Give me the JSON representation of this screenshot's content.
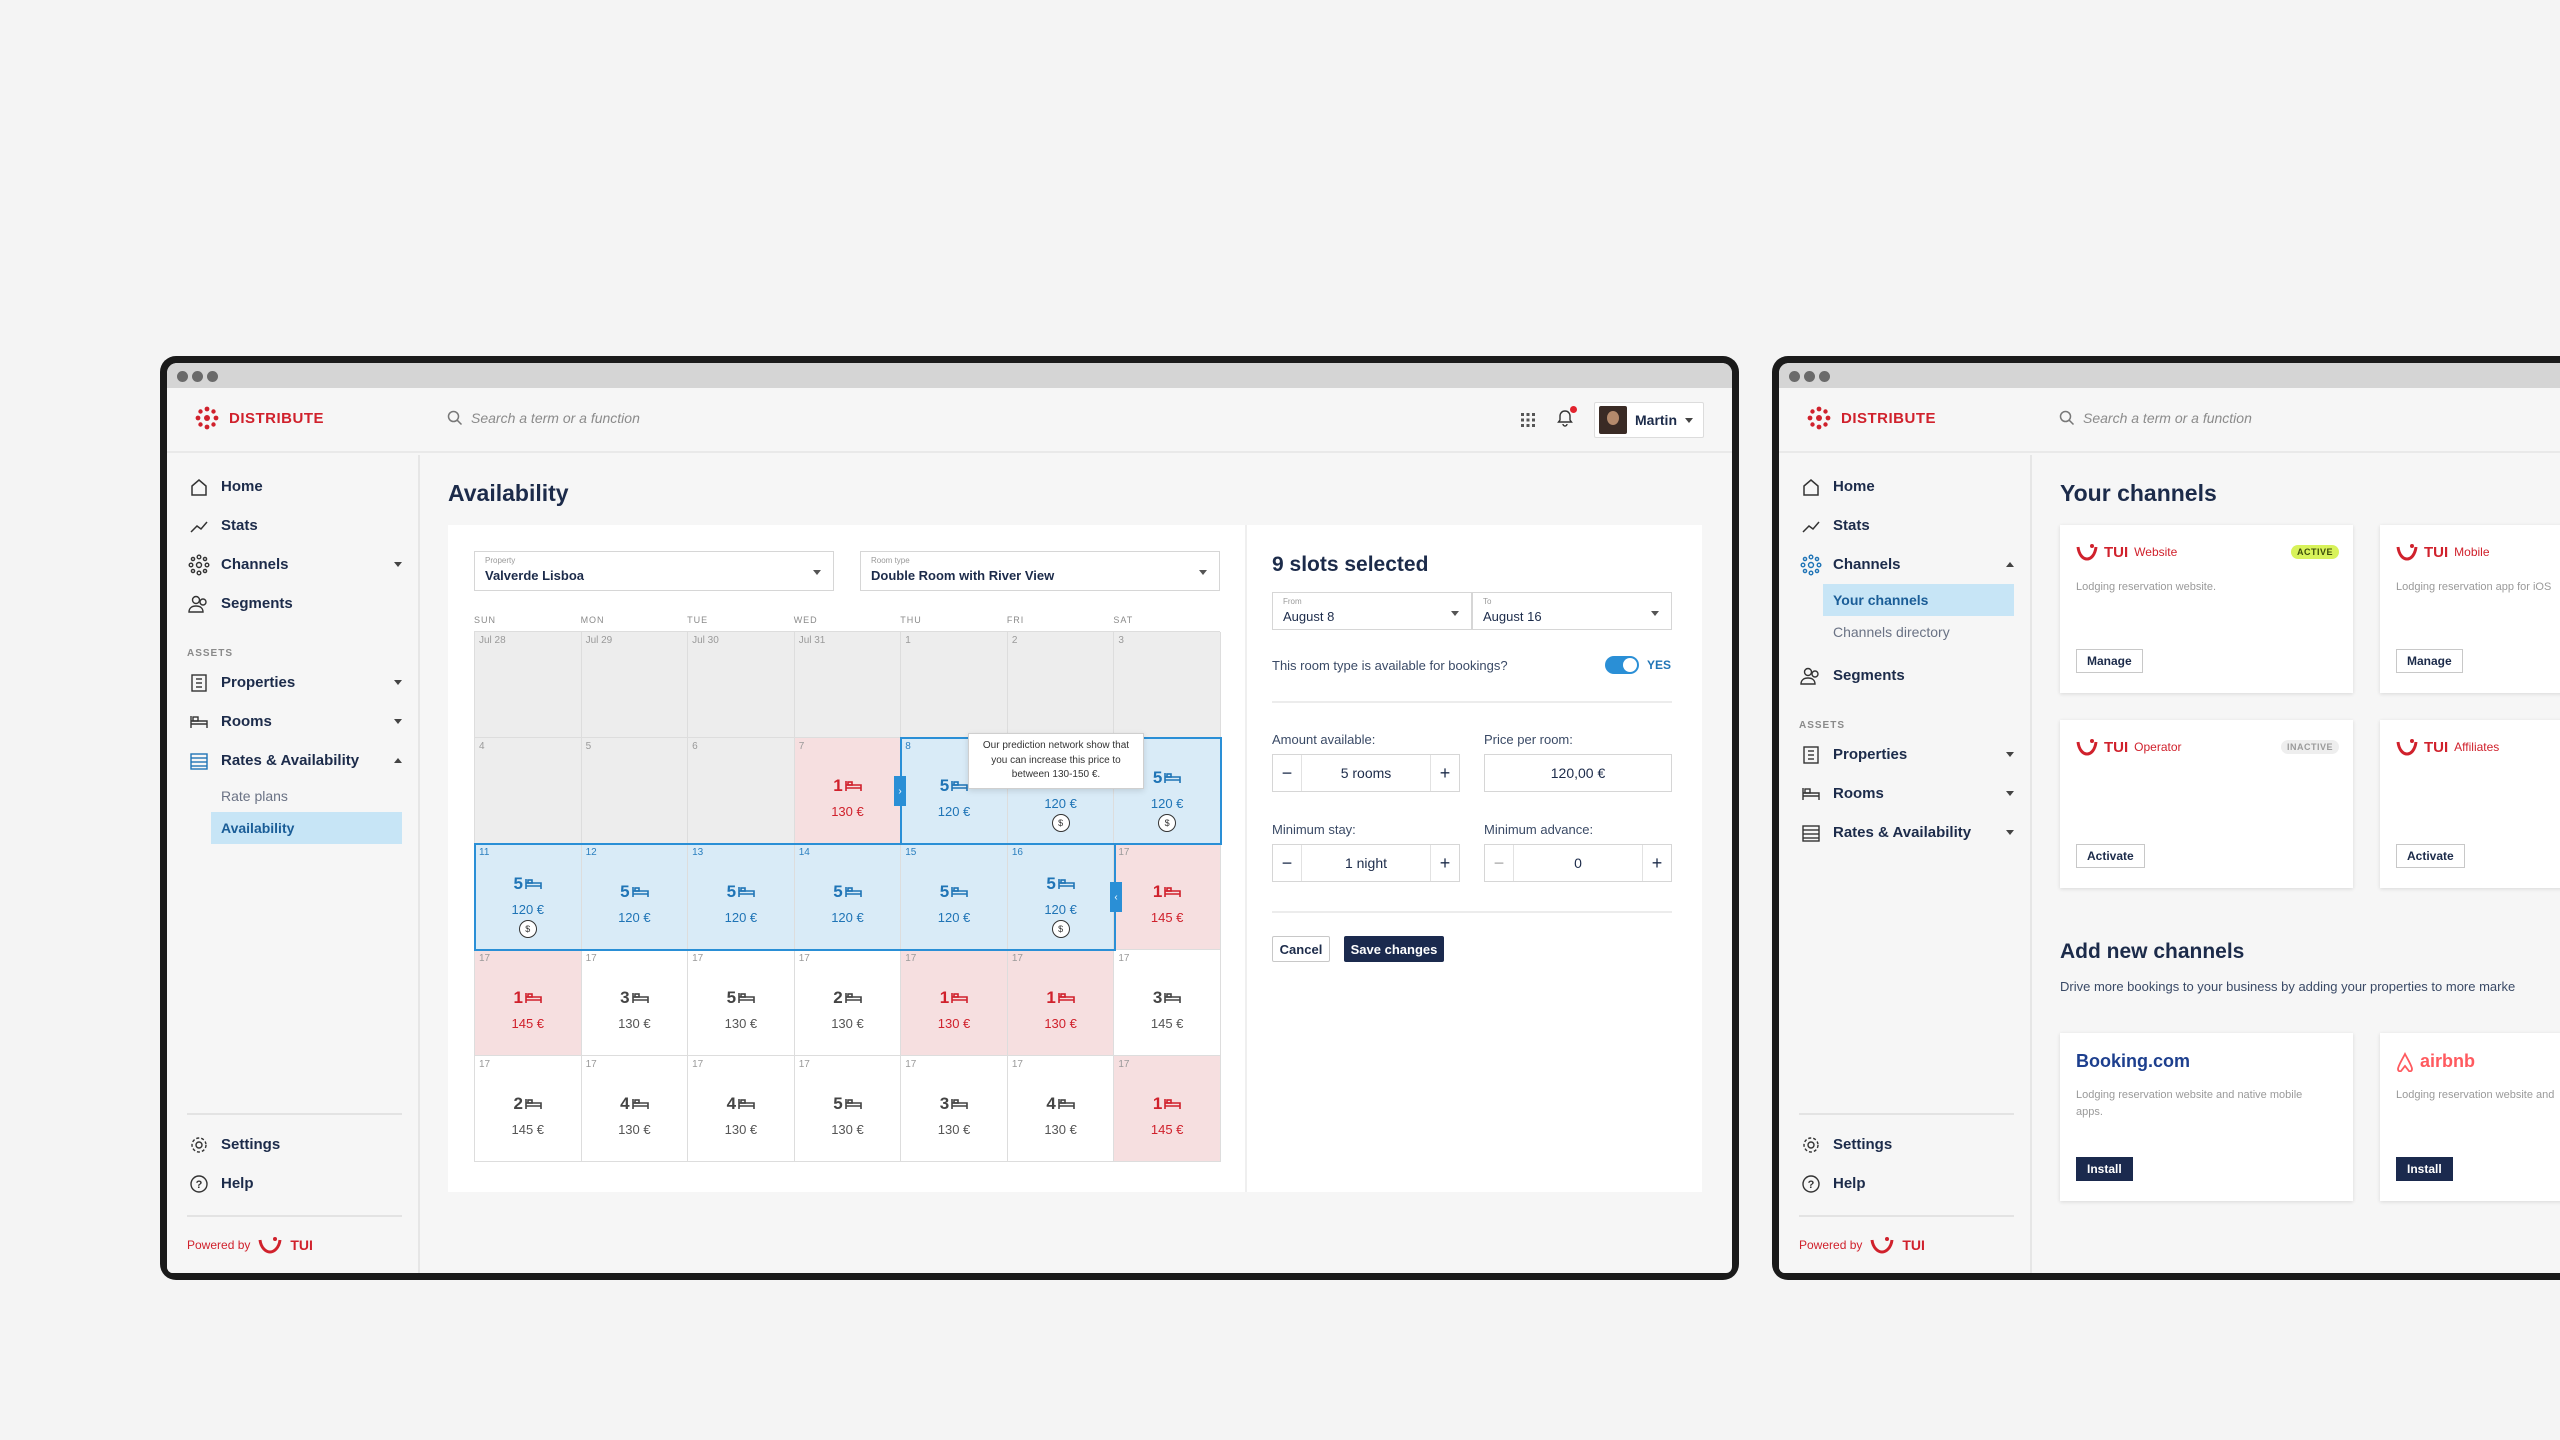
{
  "app": {
    "name": "DISTRIBUTE",
    "brand_color": "#d0212c",
    "accent": "#2a8fd6",
    "navy": "#1b2a4e"
  },
  "search": {
    "placeholder": "Search a term or a function"
  },
  "user": {
    "name": "Martin"
  },
  "sidebar": {
    "home": "Home",
    "stats": "Stats",
    "channels": "Channels",
    "segments": "Segments",
    "assets_title": "ASSETS",
    "properties": "Properties",
    "rooms": "Rooms",
    "rates": "Rates & Availability",
    "rate_plans": "Rate plans",
    "availability": "Availability",
    "your_channels": "Your channels",
    "channels_directory": "Channels directory",
    "settings": "Settings",
    "help": "Help",
    "powered_by": "Powered by",
    "tui": "TUI"
  },
  "availability": {
    "title": "Availability",
    "property_label": "Property",
    "property_value": "Valverde Lisboa",
    "roomtype_label": "Room type",
    "roomtype_value": "Double Room with River View",
    "days": [
      "SUN",
      "MON",
      "TUE",
      "WED",
      "THU",
      "FRI",
      "SAT"
    ],
    "tooltip": "Our prediction network show that you can increase this price to between 130-150 €.",
    "rows": [
      [
        {
          "d": "Jul 28",
          "s": "empty"
        },
        {
          "d": "Jul 29",
          "s": "empty"
        },
        {
          "d": "Jul 30",
          "s": "empty"
        },
        {
          "d": "Jul 31",
          "s": "empty"
        },
        {
          "d": "1",
          "s": "empty"
        },
        {
          "d": "2",
          "s": "empty"
        },
        {
          "d": "3",
          "s": "empty"
        }
      ],
      [
        {
          "d": "4",
          "s": "empty"
        },
        {
          "d": "5",
          "s": "empty"
        },
        {
          "d": "6",
          "s": "empty"
        },
        {
          "d": "7",
          "s": "red",
          "c": "1",
          "p": "130 €"
        },
        {
          "d": "8",
          "s": "blue",
          "c": "5",
          "p": "120 €"
        },
        {
          "d": "9",
          "s": "blue",
          "c": "5",
          "p": "120 €",
          "up": true
        },
        {
          "d": "10",
          "s": "blue",
          "c": "5",
          "p": "120 €",
          "up": true
        }
      ],
      [
        {
          "d": "11",
          "s": "blue",
          "c": "5",
          "p": "120 €",
          "up": true
        },
        {
          "d": "12",
          "s": "blue",
          "c": "5",
          "p": "120 €"
        },
        {
          "d": "13",
          "s": "blue",
          "c": "5",
          "p": "120 €"
        },
        {
          "d": "14",
          "s": "blue",
          "c": "5",
          "p": "120 €"
        },
        {
          "d": "15",
          "s": "blue",
          "c": "5",
          "p": "120 €"
        },
        {
          "d": "16",
          "s": "blue",
          "c": "5",
          "p": "120 €",
          "up": true
        },
        {
          "d": "17",
          "s": "red",
          "c": "1",
          "p": "145 €"
        }
      ],
      [
        {
          "d": "17",
          "s": "red",
          "c": "1",
          "p": "145 €"
        },
        {
          "d": "17",
          "s": "white",
          "c": "3",
          "p": "130 €"
        },
        {
          "d": "17",
          "s": "white",
          "c": "5",
          "p": "130 €"
        },
        {
          "d": "17",
          "s": "white",
          "c": "2",
          "p": "130 €"
        },
        {
          "d": "17",
          "s": "red",
          "c": "1",
          "p": "130 €"
        },
        {
          "d": "17",
          "s": "red",
          "c": "1",
          "p": "130 €"
        },
        {
          "d": "17",
          "s": "white",
          "c": "3",
          "p": "145 €"
        }
      ],
      [
        {
          "d": "17",
          "s": "white",
          "c": "2",
          "p": "145 €"
        },
        {
          "d": "17",
          "s": "white",
          "c": "4",
          "p": "130 €"
        },
        {
          "d": "17",
          "s": "white",
          "c": "4",
          "p": "130 €"
        },
        {
          "d": "17",
          "s": "white",
          "c": "5",
          "p": "130 €"
        },
        {
          "d": "17",
          "s": "white",
          "c": "3",
          "p": "130 €"
        },
        {
          "d": "17",
          "s": "white",
          "c": "4",
          "p": "130 €"
        },
        {
          "d": "17",
          "s": "red",
          "c": "1",
          "p": "145 €"
        }
      ]
    ],
    "form": {
      "title": "9 slots selected",
      "from_label": "From",
      "from_value": "August 8",
      "to_label": "To",
      "to_value": "August 16",
      "available_q": "This room type is available for bookings?",
      "yes": "YES",
      "amount_label": "Amount available:",
      "amount_value": "5 rooms",
      "price_label": "Price per room:",
      "price_value": "120,00 €",
      "minstay_label": "Minimum stay:",
      "minstay_value": "1 night",
      "minadv_label": "Minimum advance:",
      "minadv_value": "0",
      "cancel": "Cancel",
      "save": "Save changes"
    }
  },
  "channels": {
    "title": "Your channels",
    "cards": [
      {
        "name": "Website",
        "desc": "Lodging reservation website.",
        "badge": "ACTIVE",
        "button": "Manage"
      },
      {
        "name": "Mobile",
        "desc": "Lodging reservation app for iOS",
        "badge": "",
        "button": "Manage"
      },
      {
        "name": "Operator",
        "desc": "",
        "badge": "INACTIVE",
        "button": "Activate"
      },
      {
        "name": "Affiliates",
        "desc": "",
        "badge": "",
        "button": "Activate"
      }
    ],
    "add_title": "Add new channels",
    "add_sub": "Drive more bookings to your business by adding your properties to more marke",
    "add_cards": [
      {
        "name": "Booking.com",
        "desc": "Lodging reservation website and native mobile apps.",
        "button": "Install"
      },
      {
        "name": "airbnb",
        "desc": "Lodging reservation website and",
        "button": "Install"
      }
    ]
  }
}
